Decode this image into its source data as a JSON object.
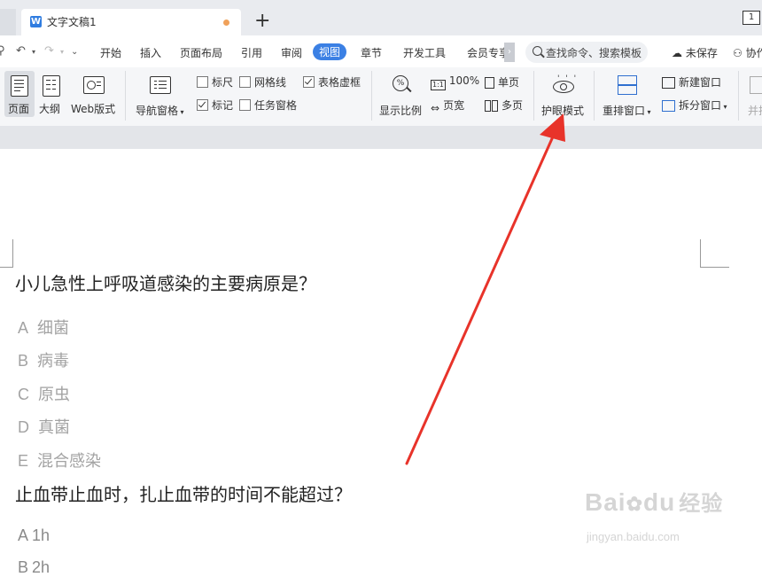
{
  "titlebar": {
    "doc_tab_title": "文字文稿1",
    "doc_tab_icon": "W",
    "new_tab_symbol": "+",
    "window_badge": "1"
  },
  "menu": {
    "items": [
      "开始",
      "插入",
      "页面布局",
      "引用",
      "审阅",
      "视图",
      "章节",
      "开发工具",
      "会员专享"
    ],
    "active": "视图",
    "search_placeholder": "查找命令、搜索模板",
    "unsaved": "未保存",
    "collab": "协作"
  },
  "ribbon": {
    "view_modes": [
      "页面",
      "大纲",
      "Web版式"
    ],
    "nav_pane": "导航窗格",
    "checks": [
      {
        "label": "标尺",
        "checked": false
      },
      {
        "label": "网格线",
        "checked": false
      },
      {
        "label": "表格虚框",
        "checked": true
      },
      {
        "label": "标记",
        "checked": true
      },
      {
        "label": "任务窗格",
        "checked": false
      }
    ],
    "zoom_label": "显示比例",
    "zoom_100": "100%",
    "page_width": "页宽",
    "single_page": "单页",
    "multi_page": "多页",
    "eye_mode": "护眼模式",
    "rearrange": "重排窗口",
    "new_window": "新建窗口",
    "split_window": "拆分窗口",
    "side_by_side": "并排"
  },
  "document": {
    "questions": [
      {
        "text": "小儿急性上呼吸道感染的主要病原是？",
        "options": [
          {
            "letter": "A",
            "text": "细菌"
          },
          {
            "letter": "B",
            "text": "病毒"
          },
          {
            "letter": "C",
            "text": "原虫"
          },
          {
            "letter": "D",
            "text": "真菌"
          },
          {
            "letter": "E",
            "text": "混合感染"
          }
        ]
      },
      {
        "text": "止血带止血时，扎止血带的时间不能超过？",
        "options": [
          {
            "letter": "A",
            "text": "1h"
          },
          {
            "letter": "B",
            "text": "2h"
          }
        ]
      }
    ]
  },
  "watermark": {
    "brand": "Bai",
    "brand2": "du",
    "brand_cn": "经验",
    "url": "jingyan.baidu.com"
  },
  "annotation_color": "#e8332a",
  "accent_color": "#3b80e4"
}
